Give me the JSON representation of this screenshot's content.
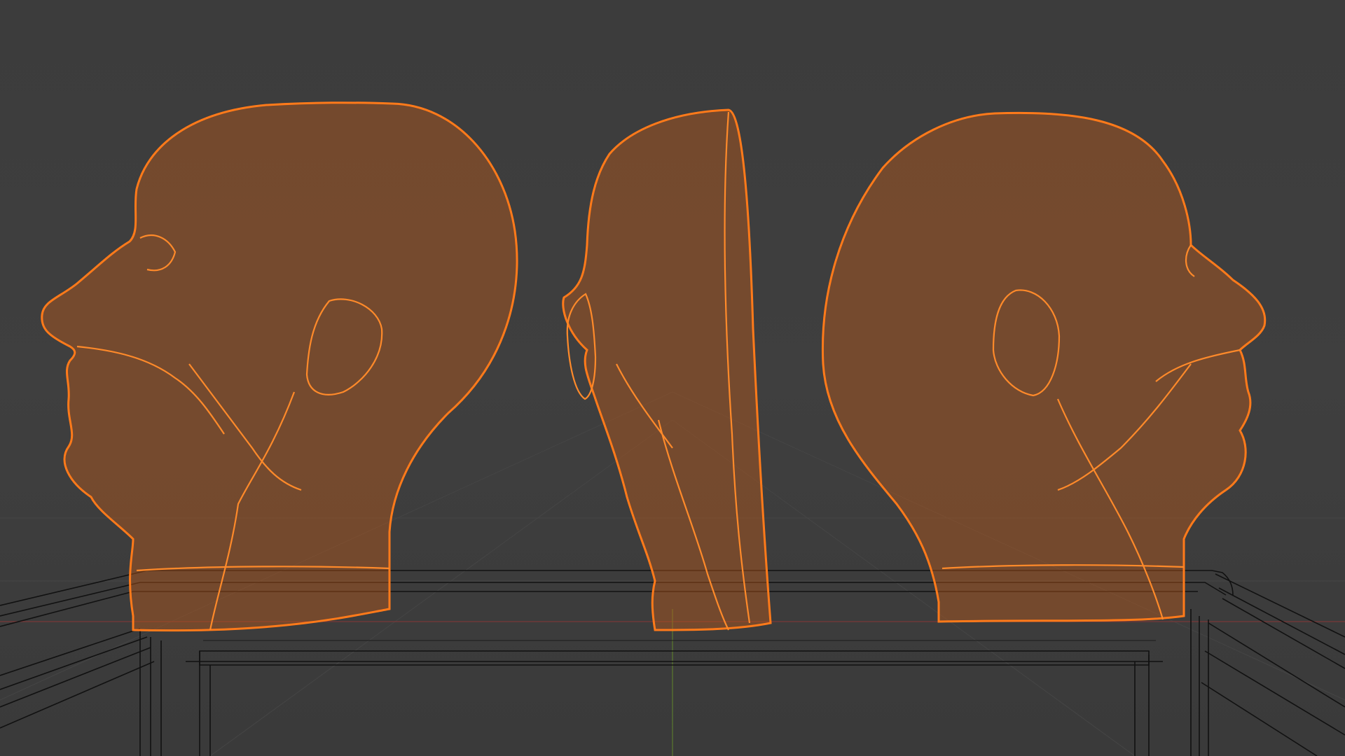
{
  "viewport": {
    "mode": "wireframe",
    "background": "#3d3d3d",
    "selection_color": "#ff7a1a",
    "x_axis_color": "#8a3a3a",
    "y_axis_color": "#4e6e2e"
  },
  "objects": [
    {
      "name": "head-left",
      "view": "side-left",
      "icon": "wireframe-head-icon"
    },
    {
      "name": "head-center",
      "view": "front-edge",
      "icon": "wireframe-head-icon"
    },
    {
      "name": "head-right",
      "view": "side-right",
      "icon": "wireframe-head-icon"
    }
  ],
  "scene": {
    "table": "wireframe-table"
  }
}
